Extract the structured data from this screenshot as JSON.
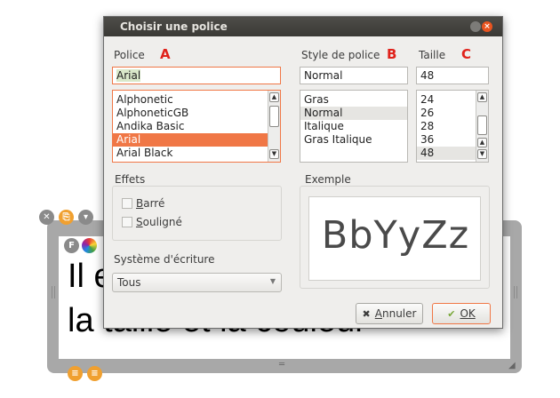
{
  "background_box": {
    "line1": "Il e",
    "line2": "la taille et la couleur"
  },
  "dialog": {
    "title": "Choisir une police",
    "close_symbol": "×",
    "font_label": "Police",
    "font_marker": "A",
    "style_label": "Style de police",
    "style_marker": "B",
    "size_label": "Taille",
    "size_marker": "C",
    "font_value": "Arial",
    "style_value": "Normal",
    "size_value": "48",
    "fonts": [
      "Alphonetic",
      "AlphoneticGB",
      "Andika Basic",
      "Arial",
      "Arial Black"
    ],
    "fonts_selected": "Arial",
    "styles": [
      "Gras",
      "Normal",
      "Italique",
      "Gras Italique"
    ],
    "styles_selected": "Normal",
    "sizes": [
      "24",
      "26",
      "28",
      "36",
      "48"
    ],
    "sizes_selected": "48",
    "effects_title": "Effets",
    "strike_label": "Barré",
    "underline_label": "Souligné",
    "writing_system_label": "Système d'écriture",
    "writing_system_value": "Tous",
    "sample_title": "Exemple",
    "sample_text": "BbYyZz",
    "cancel_label": "Annuler",
    "ok_label": "OK"
  },
  "colors": {
    "accent": "#f07746",
    "marker": "#e0221b",
    "titlebar": "#3a3935"
  },
  "icons": {
    "close": "close-icon",
    "cancel": "x-icon",
    "ok": "checkmark-icon",
    "scroll_up": "arrow-up-icon",
    "scroll_down": "arrow-down-icon",
    "dropdown": "chevron-down-icon"
  }
}
